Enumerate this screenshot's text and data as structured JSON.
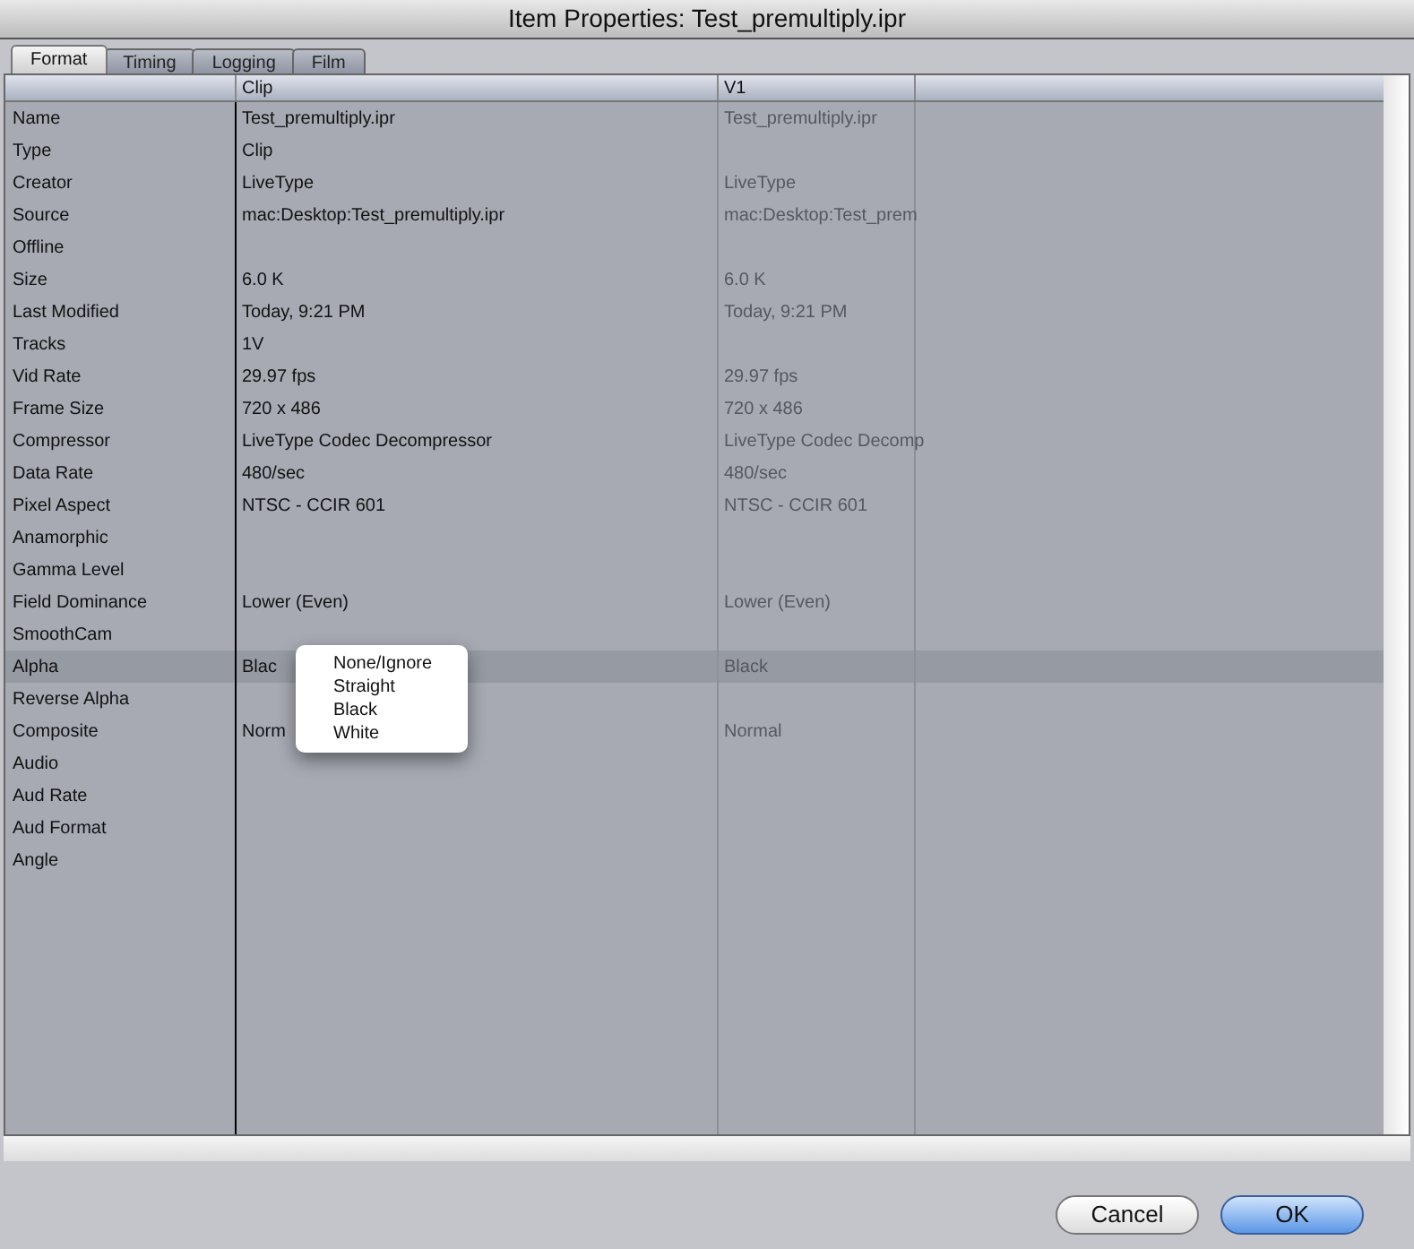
{
  "window": {
    "title": "Item Properties: Test_premultiply.ipr"
  },
  "tabs": [
    {
      "label": "Format",
      "selected": true
    },
    {
      "label": "Timing",
      "selected": false
    },
    {
      "label": "Logging",
      "selected": false
    },
    {
      "label": "Film",
      "selected": false
    }
  ],
  "table": {
    "columns": [
      "Clip",
      "V1"
    ],
    "rows": [
      {
        "label": "Name",
        "clip": "Test_premultiply.ipr",
        "v1": "Test_premultiply.ipr",
        "selected": false
      },
      {
        "label": "Type",
        "clip": "Clip",
        "selected": false
      },
      {
        "label": "Creator",
        "clip": "LiveType",
        "v1": "LiveType",
        "selected": false
      },
      {
        "label": "Source",
        "clip": "mac:Desktop:Test_premultiply.ipr",
        "v1": "mac:Desktop:Test_prem",
        "selected": false
      },
      {
        "label": "Offline",
        "selected": false
      },
      {
        "label": "Size",
        "clip": "6.0 K",
        "v1": "6.0 K",
        "selected": false
      },
      {
        "label": "Last Modified",
        "clip": "Today, 9:21 PM",
        "v1": "Today, 9:21 PM",
        "selected": false
      },
      {
        "label": "Tracks",
        "clip": "1V",
        "selected": false
      },
      {
        "label": "Vid Rate",
        "clip": "29.97 fps",
        "v1": "29.97 fps",
        "selected": false
      },
      {
        "label": "Frame Size",
        "clip": "720 x 486",
        "v1": "720 x 486",
        "selected": false
      },
      {
        "label": "Compressor",
        "clip": "LiveType Codec Decompressor",
        "v1": "LiveType Codec Decomp",
        "selected": false
      },
      {
        "label": "Data Rate",
        "clip": "480/sec",
        "v1": "480/sec",
        "selected": false
      },
      {
        "label": "Pixel Aspect",
        "clip": "NTSC - CCIR 601",
        "v1": "NTSC - CCIR 601",
        "selected": false
      },
      {
        "label": "Anamorphic",
        "selected": false
      },
      {
        "label": "Gamma Level",
        "selected": false
      },
      {
        "label": "Field Dominance",
        "clip": "Lower (Even)",
        "v1": "Lower (Even)",
        "selected": false
      },
      {
        "label": "SmoothCam",
        "selected": false
      },
      {
        "label": "Alpha",
        "clip": "Blac",
        "v1": "Black",
        "selected": true
      },
      {
        "label": "Reverse Alpha",
        "selected": false
      },
      {
        "label": "Composite",
        "clip": "Norm",
        "v1": "Normal",
        "selected": false
      },
      {
        "label": "Audio",
        "selected": false
      },
      {
        "label": "Aud Rate",
        "selected": false
      },
      {
        "label": "Aud Format",
        "selected": false
      },
      {
        "label": "Angle",
        "selected": false
      }
    ]
  },
  "popup_menu": {
    "items": [
      "None/Ignore",
      "Straight",
      "Black",
      "White"
    ]
  },
  "buttons": [
    {
      "label": "Cancel",
      "default": false
    },
    {
      "label": "OK",
      "default": true
    }
  ]
}
